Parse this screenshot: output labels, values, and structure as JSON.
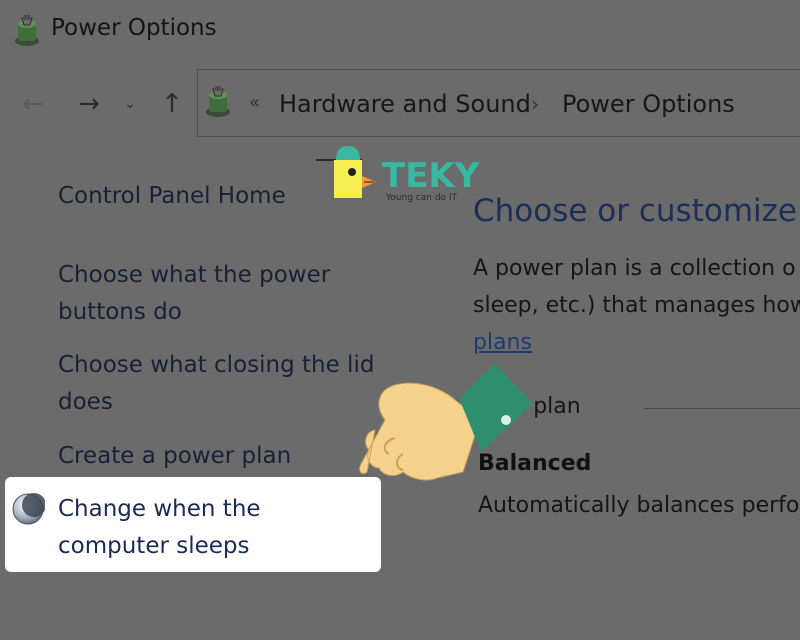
{
  "window": {
    "title": "Power Options"
  },
  "nav": {
    "back_icon": "arrow-left-icon",
    "forward_icon": "arrow-right-icon",
    "recent_icon": "chevron-down-icon",
    "up_icon": "arrow-up-icon"
  },
  "address": {
    "overflow": "«",
    "separator": "›",
    "crumbs": [
      "Hardware and Sound",
      "Power Options"
    ]
  },
  "sidebar": {
    "items": [
      {
        "label": "Control Panel Home"
      },
      {
        "label": "Choose what the power buttons do"
      },
      {
        "label": "Choose what closing the lid does"
      },
      {
        "label": "Create a power plan"
      },
      {
        "label": "Change when the computer sleeps",
        "icon": "moon-icon",
        "highlighted": true
      }
    ]
  },
  "main": {
    "heading": "Choose or customize",
    "description_lines": [
      "A power plan is a collection o",
      "sleep, etc.) that manages how"
    ],
    "plans_link": "plans",
    "selected_plan_label": "cted plan",
    "plan_name": "Balanced",
    "plan_description": "Automatically balances perfo"
  },
  "watermark": {
    "brand": "TEKY",
    "tagline": "Young can do IT",
    "icon": "teky-mascot-logo"
  },
  "overlay": {
    "icon": "pointing-hand-icon"
  },
  "colors": {
    "background_dim": "#6b6b6b",
    "highlight": "#ffffff",
    "link": "#1b2e55",
    "brand_teal": "#39b7a1",
    "brand_yellow": "#f4ee52",
    "hand_skin": "#f4d28c",
    "cuff_green": "#2f8e6e"
  }
}
